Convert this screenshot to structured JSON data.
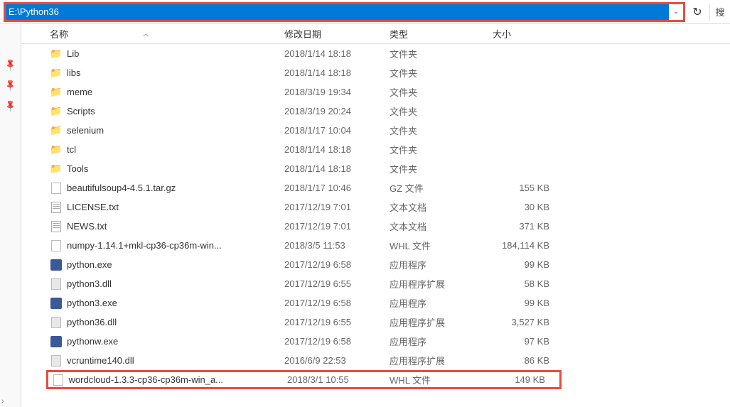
{
  "address_bar": {
    "path": "E:\\Python36"
  },
  "search_label": "搜",
  "columns": {
    "name": "名称",
    "date": "修改日期",
    "type": "类型",
    "size": "大小",
    "sort_indicator": "︿"
  },
  "files": [
    {
      "icon": "folder",
      "name": "Lib",
      "date": "2018/1/14 18:18",
      "type": "文件夹",
      "size": ""
    },
    {
      "icon": "folder",
      "name": "libs",
      "date": "2018/1/14 18:18",
      "type": "文件夹",
      "size": ""
    },
    {
      "icon": "folder",
      "name": "meme",
      "date": "2018/3/19 19:34",
      "type": "文件夹",
      "size": ""
    },
    {
      "icon": "folder",
      "name": "Scripts",
      "date": "2018/3/19 20:24",
      "type": "文件夹",
      "size": ""
    },
    {
      "icon": "folder",
      "name": "selenium",
      "date": "2018/1/17 10:04",
      "type": "文件夹",
      "size": ""
    },
    {
      "icon": "folder",
      "name": "tcl",
      "date": "2018/1/14 18:18",
      "type": "文件夹",
      "size": ""
    },
    {
      "icon": "folder",
      "name": "Tools",
      "date": "2018/1/14 18:18",
      "type": "文件夹",
      "size": ""
    },
    {
      "icon": "file",
      "name": "beautifulsoup4-4.5.1.tar.gz",
      "date": "2018/1/17 10:46",
      "type": "GZ 文件",
      "size": "155 KB"
    },
    {
      "icon": "txt",
      "name": "LICENSE.txt",
      "date": "2017/12/19 7:01",
      "type": "文本文档",
      "size": "30 KB"
    },
    {
      "icon": "txt",
      "name": "NEWS.txt",
      "date": "2017/12/19 7:01",
      "type": "文本文档",
      "size": "371 KB"
    },
    {
      "icon": "file",
      "name": "numpy-1.14.1+mkl-cp36-cp36m-win...",
      "date": "2018/3/5 11:53",
      "type": "WHL 文件",
      "size": "184,114 KB"
    },
    {
      "icon": "exe",
      "name": "python.exe",
      "date": "2017/12/19 6:58",
      "type": "应用程序",
      "size": "99 KB"
    },
    {
      "icon": "dll",
      "name": "python3.dll",
      "date": "2017/12/19 6:55",
      "type": "应用程序扩展",
      "size": "58 KB"
    },
    {
      "icon": "exe",
      "name": "python3.exe",
      "date": "2017/12/19 6:58",
      "type": "应用程序",
      "size": "99 KB"
    },
    {
      "icon": "dll",
      "name": "python36.dll",
      "date": "2017/12/19 6:55",
      "type": "应用程序扩展",
      "size": "3,527 KB"
    },
    {
      "icon": "exe",
      "name": "pythonw.exe",
      "date": "2017/12/19 6:58",
      "type": "应用程序",
      "size": "97 KB"
    },
    {
      "icon": "dll",
      "name": "vcruntime140.dll",
      "date": "2016/6/9 22:53",
      "type": "应用程序扩展",
      "size": "86 KB"
    },
    {
      "icon": "file",
      "name": "wordcloud-1.3.3-cp36-cp36m-win_a...",
      "date": "2018/3/1 10:55",
      "type": "WHL 文件",
      "size": "149 KB",
      "highlighted": true
    }
  ]
}
